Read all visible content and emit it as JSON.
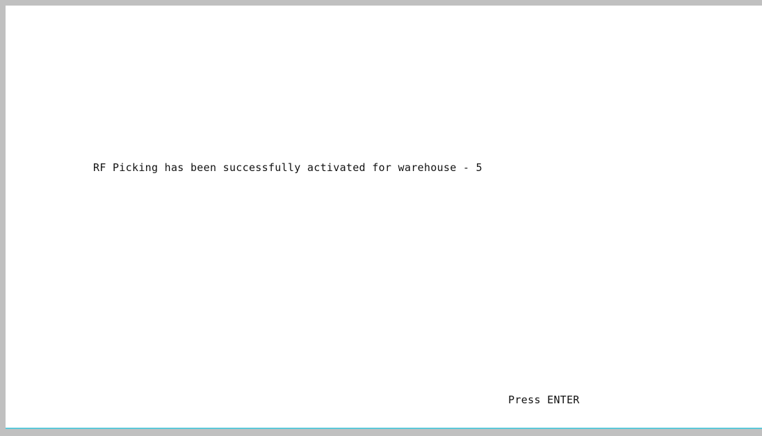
{
  "screen": {
    "message": "RF Picking has been successfully activated for warehouse - 5",
    "prompt": "Press ENTER"
  },
  "colors": {
    "border": "#c0c0c0",
    "background": "#ffffff",
    "text": "#111111",
    "rule": "#5bc8d8"
  }
}
